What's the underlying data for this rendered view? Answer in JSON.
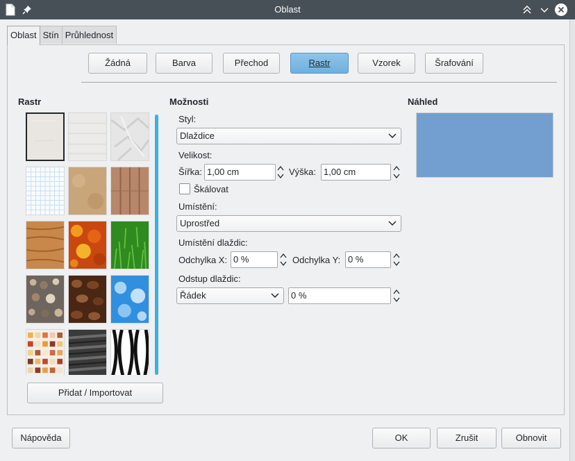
{
  "window": {
    "title": "Oblast",
    "titlebar_color": "#475057"
  },
  "tabs": [
    {
      "label": "Oblast",
      "active": true
    },
    {
      "label": "Stín",
      "active": false
    },
    {
      "label": "Průhlednost",
      "active": false
    }
  ],
  "fill_types": [
    {
      "label": "Žádná",
      "checked": false
    },
    {
      "label": "Barva",
      "checked": false
    },
    {
      "label": "Přechod",
      "checked": false
    },
    {
      "label": "Rastr",
      "checked": true
    },
    {
      "label": "Vzorek",
      "checked": false
    },
    {
      "label": "Šrafování",
      "checked": false
    }
  ],
  "bitmap_section": {
    "heading": "Rastr",
    "tiles": [
      {
        "name": "painted-white",
        "selected": true
      },
      {
        "name": "paper-texture",
        "selected": false
      },
      {
        "name": "paper-crumpled",
        "selected": false
      },
      {
        "name": "paper-graph",
        "selected": false
      },
      {
        "name": "parchment-paper",
        "selected": false
      },
      {
        "name": "fence",
        "selected": false
      },
      {
        "name": "wooden-board",
        "selected": false
      },
      {
        "name": "maple-leaves",
        "selected": false
      },
      {
        "name": "lawn",
        "selected": false
      },
      {
        "name": "colorful-pebbles",
        "selected": false
      },
      {
        "name": "coffee-beans",
        "selected": false
      },
      {
        "name": "little-clouds",
        "selected": false
      },
      {
        "name": "color-stripes",
        "selected": false
      },
      {
        "name": "invoice-paper",
        "selected": false
      },
      {
        "name": "zebra",
        "selected": false
      }
    ],
    "import_button": "Přidat / Importovat"
  },
  "options": {
    "heading": "Možnosti",
    "style_label": "Styl:",
    "style_value": "Dlaždice",
    "size_label": "Velikost:",
    "width_label": "Šířka:",
    "width_value": "1,00 cm",
    "height_label": "Výška:",
    "height_value": "1,00 cm",
    "scale_label": "Škálovat",
    "scale_checked": false,
    "position_label": "Umístění:",
    "position_value": "Uprostřed",
    "tile_position_label": "Umístění dlaždic:",
    "offset_x_label": "Odchylka X:",
    "offset_x_value": "0 %",
    "offset_y_label": "Odchylka Y:",
    "offset_y_value": "0 %",
    "tile_offset_label": "Odstup dlaždic:",
    "tile_offset_mode": "Řádek",
    "tile_offset_value": "0 %"
  },
  "preview": {
    "heading": "Náhled",
    "color": "#729fcf"
  },
  "footer": {
    "help": "Nápověda",
    "ok": "OK",
    "cancel": "Zrušit",
    "reset": "Obnovit"
  },
  "colors": {
    "accent": "#3daee9",
    "checked_button": "#7ab8e4"
  }
}
